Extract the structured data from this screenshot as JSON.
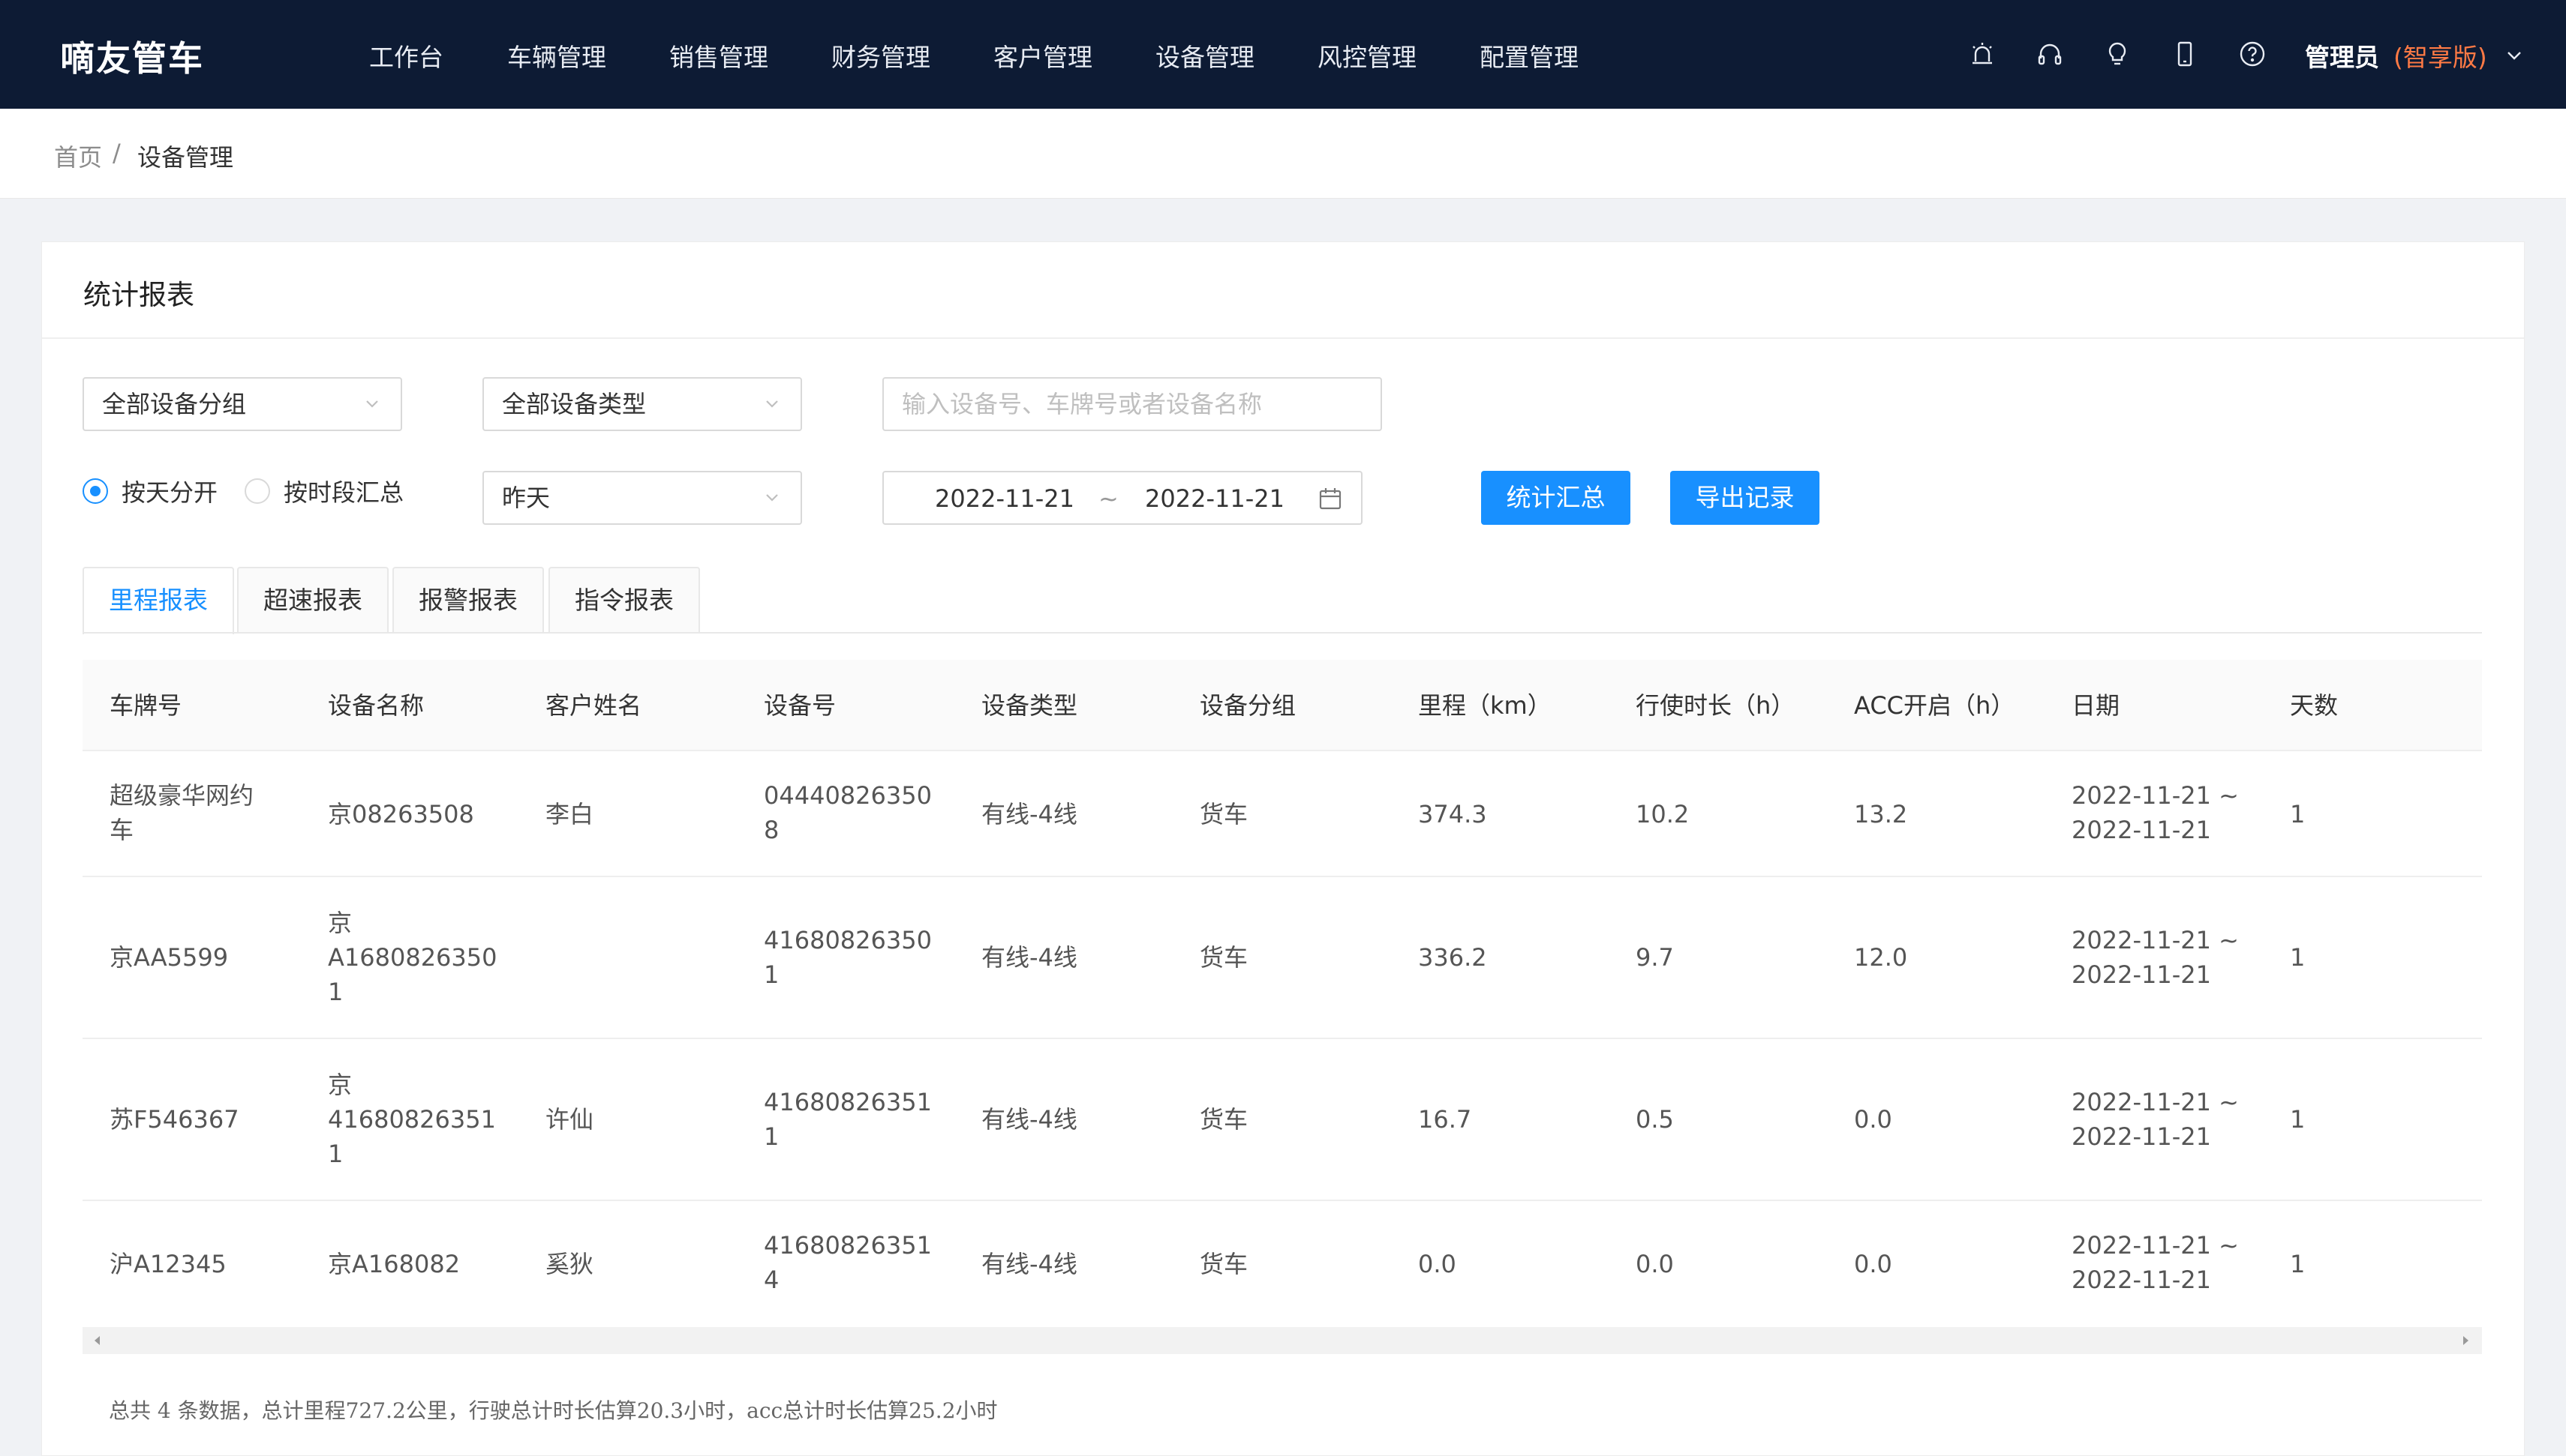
{
  "app": {
    "brand": "嘀友管车"
  },
  "nav": {
    "items": [
      "工作台",
      "车辆管理",
      "销售管理",
      "财务管理",
      "客户管理",
      "设备管理",
      "风控管理",
      "配置管理"
    ]
  },
  "toolbar_icons": [
    "alarm-icon",
    "headset-icon",
    "lightbulb-icon",
    "mobile-icon",
    "help-icon"
  ],
  "user": {
    "name": "管理员",
    "edition": "(智享版)"
  },
  "breadcrumb": {
    "home": "首页",
    "separator": "/",
    "current": "设备管理"
  },
  "card": {
    "title": "统计报表"
  },
  "filters": {
    "device_group": "全部设备分组",
    "device_type": "全部设备类型",
    "search_placeholder": "输入设备号、车牌号或者设备名称",
    "mode_by_day": "按天分开",
    "mode_by_period": "按时段汇总",
    "mode_selected": "by_day",
    "period": "昨天",
    "date_start": "2022-11-21",
    "date_sep": "~",
    "date_end": "2022-11-21",
    "btn_summary": "统计汇总",
    "btn_export": "导出记录"
  },
  "tabs": [
    {
      "label": "里程报表",
      "active": true
    },
    {
      "label": "超速报表",
      "active": false
    },
    {
      "label": "报警报表",
      "active": false
    },
    {
      "label": "指令报表",
      "active": false
    }
  ],
  "table": {
    "columns": [
      "车牌号",
      "设备名称",
      "客户姓名",
      "设备号",
      "设备类型",
      "设备分组",
      "里程（km）",
      "行使时长（h）",
      "ACC开启（h）",
      "日期",
      "天数"
    ],
    "rows": [
      [
        "超级豪华网约\n车",
        "京08263508",
        "李白",
        "04440826350\n8",
        "有线-4线",
        "货车",
        "374.3",
        "10.2",
        "13.2",
        "2022-11-21 ~\n2022-11-21",
        "1"
      ],
      [
        "京AA5599",
        "京\nA1680826350\n1",
        "",
        "41680826350\n1",
        "有线-4线",
        "货车",
        "336.2",
        "9.7",
        "12.0",
        "2022-11-21 ~\n2022-11-21",
        "1"
      ],
      [
        "苏F546367",
        "京\n41680826351\n1",
        "许仙",
        "41680826351\n1",
        "有线-4线",
        "货车",
        "16.7",
        "0.5",
        "0.0",
        "2022-11-21 ~\n2022-11-21",
        "1"
      ],
      [
        "沪A12345",
        "京A168082",
        "奚狄",
        "41680826351\n4",
        "有线-4线",
        "货车",
        "0.0",
        "0.0",
        "0.0",
        "2022-11-21 ~\n2022-11-21",
        "1"
      ]
    ]
  },
  "summary": "总共 4 条数据，总计里程727.2公里，行驶总计时长估算20.3小时，acc总计时长估算25.2小时",
  "colors": {
    "topbar": "#0d1b34",
    "accent": "#1890ff",
    "edition": "#ff7a45"
  }
}
